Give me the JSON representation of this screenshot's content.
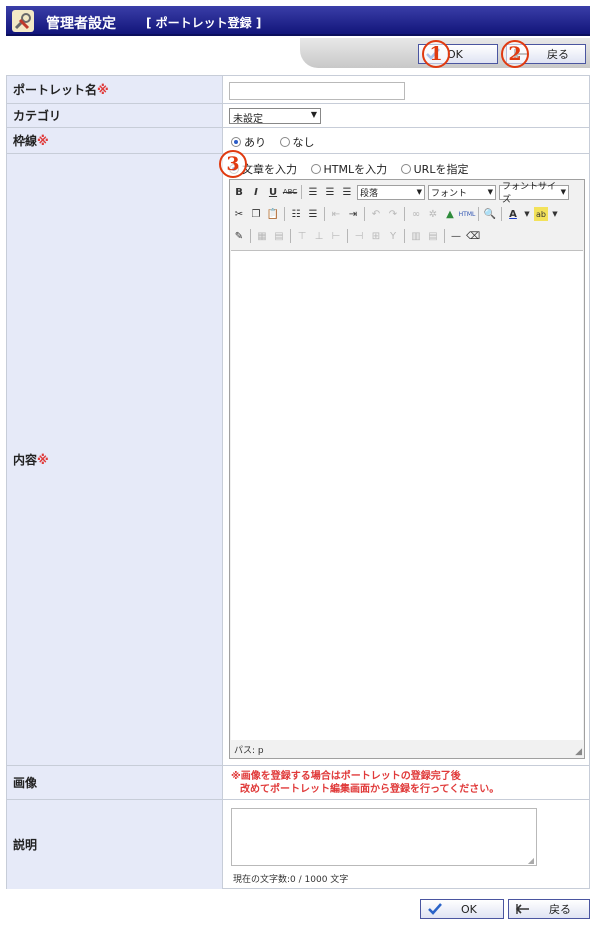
{
  "header": {
    "title": "管理者設定",
    "subtitle": "[ ポートレット登録 ]"
  },
  "toolbar": {
    "ok_label": "OK",
    "back_label": "戻る"
  },
  "badges": [
    "1",
    "2",
    "3"
  ],
  "form": {
    "name_label": "ポートレット名",
    "required_mark": "※",
    "category_label": "カテゴリ",
    "category_value": "未設定",
    "border_label": "枠線",
    "border_options": [
      "あり",
      "なし"
    ],
    "content_label": "内容",
    "content_modes": [
      "文章を入力",
      "HTMLを入力",
      "URLを指定"
    ],
    "editor": {
      "format_select": "段落",
      "font_select": "フォント",
      "size_select": "フォントサイズ",
      "path_label": "パス: p"
    },
    "image_label": "画像",
    "image_note_line1": "※画像を登録する場合はポートレットの登録完了後",
    "image_note_line2": "改めてポートレット編集画面から登録を行ってください。",
    "desc_label": "説明",
    "char_count": "現在の文字数:0 / 1000 文字"
  },
  "colors": {
    "header": "#12157a",
    "label_bg": "#e6eaf8",
    "required": "#e03a3a",
    "badge": "#e03a10"
  }
}
